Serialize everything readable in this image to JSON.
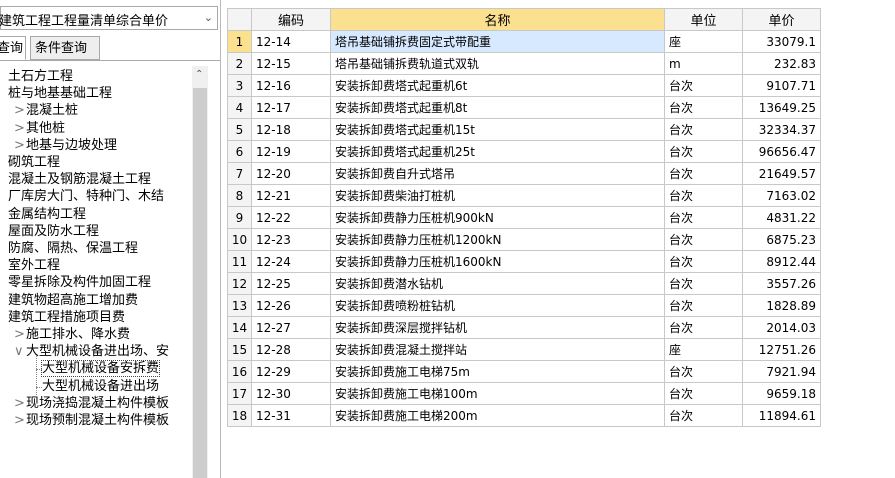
{
  "left_panel": {
    "library_select": "建筑工程工程量清单综合单价",
    "tabs": [
      "查询",
      "条件查询"
    ],
    "tree": [
      {
        "label": "土石方工程",
        "depth": 0,
        "toggle": ""
      },
      {
        "label": "桩与地基基础工程",
        "depth": 0,
        "toggle": ""
      },
      {
        "label": "混凝土桩",
        "depth": 1,
        "toggle": ">"
      },
      {
        "label": "其他桩",
        "depth": 1,
        "toggle": ">"
      },
      {
        "label": "地基与边坡处理",
        "depth": 1,
        "toggle": ">"
      },
      {
        "label": "砌筑工程",
        "depth": 0,
        "toggle": ""
      },
      {
        "label": "混凝土及钢筋混凝土工程",
        "depth": 0,
        "toggle": ""
      },
      {
        "label": "厂库房大门、特种门、木结",
        "depth": 0,
        "toggle": ""
      },
      {
        "label": "金属结构工程",
        "depth": 0,
        "toggle": ""
      },
      {
        "label": "屋面及防水工程",
        "depth": 0,
        "toggle": ""
      },
      {
        "label": "防腐、隔热、保温工程",
        "depth": 0,
        "toggle": ""
      },
      {
        "label": "室外工程",
        "depth": 0,
        "toggle": ""
      },
      {
        "label": "零星拆除及构件加固工程",
        "depth": 0,
        "toggle": ""
      },
      {
        "label": "建筑物超高施工增加费",
        "depth": 0,
        "toggle": ""
      },
      {
        "label": "建筑工程措施项目费",
        "depth": 0,
        "toggle": ""
      },
      {
        "label": "施工排水、降水费",
        "depth": 1,
        "toggle": ">"
      },
      {
        "label": "大型机械设备进出场、安",
        "depth": 1,
        "toggle": "v"
      },
      {
        "label": "大型机械设备安拆费",
        "depth": 2,
        "toggle": "",
        "selected": true
      },
      {
        "label": "大型机械设备进出场",
        "depth": 2,
        "toggle": ""
      },
      {
        "label": "现场浇捣混凝土构件模板",
        "depth": 1,
        "toggle": ">"
      },
      {
        "label": "现场预制混凝土构件模板",
        "depth": 1,
        "toggle": ">"
      }
    ]
  },
  "grid": {
    "columns": [
      "编码",
      "名称",
      "单位",
      "单价"
    ],
    "rows": [
      {
        "n": "1",
        "code": "12-14",
        "name": "塔吊基础铺拆费固定式带配重",
        "unit": "座",
        "price": "33079.1"
      },
      {
        "n": "2",
        "code": "12-15",
        "name": "塔吊基础铺拆费轨道式双轨",
        "unit": "m",
        "price": "232.83"
      },
      {
        "n": "3",
        "code": "12-16",
        "name": "安装拆卸费塔式起重机6t",
        "unit": "台次",
        "price": "9107.71"
      },
      {
        "n": "4",
        "code": "12-17",
        "name": "安装拆卸费塔式起重机8t",
        "unit": "台次",
        "price": "13649.25"
      },
      {
        "n": "5",
        "code": "12-18",
        "name": "安装拆卸费塔式起重机15t",
        "unit": "台次",
        "price": "32334.37"
      },
      {
        "n": "6",
        "code": "12-19",
        "name": "安装拆卸费塔式起重机25t",
        "unit": "台次",
        "price": "96656.47"
      },
      {
        "n": "7",
        "code": "12-20",
        "name": "安装拆卸费自升式塔吊",
        "unit": "台次",
        "price": "21649.57"
      },
      {
        "n": "8",
        "code": "12-21",
        "name": "安装拆卸费柴油打桩机",
        "unit": "台次",
        "price": "7163.02"
      },
      {
        "n": "9",
        "code": "12-22",
        "name": "安装拆卸费静力压桩机900kN",
        "unit": "台次",
        "price": "4831.22"
      },
      {
        "n": "10",
        "code": "12-23",
        "name": "安装拆卸费静力压桩机1200kN",
        "unit": "台次",
        "price": "6875.23"
      },
      {
        "n": "11",
        "code": "12-24",
        "name": "安装拆卸费静力压桩机1600kN",
        "unit": "台次",
        "price": "8912.44"
      },
      {
        "n": "12",
        "code": "12-25",
        "name": "安装拆卸费潜水钻机",
        "unit": "台次",
        "price": "3557.26"
      },
      {
        "n": "13",
        "code": "12-26",
        "name": "安装拆卸费喷粉桩钻机",
        "unit": "台次",
        "price": "1828.89"
      },
      {
        "n": "14",
        "code": "12-27",
        "name": "安装拆卸费深层搅拌钻机",
        "unit": "台次",
        "price": "2014.03"
      },
      {
        "n": "15",
        "code": "12-28",
        "name": "安装拆卸费混凝土搅拌站",
        "unit": "座",
        "price": "12751.26"
      },
      {
        "n": "16",
        "code": "12-29",
        "name": "安装拆卸费施工电梯75m",
        "unit": "台次",
        "price": "7921.94"
      },
      {
        "n": "17",
        "code": "12-30",
        "name": "安装拆卸费施工电梯100m",
        "unit": "台次",
        "price": "9659.18"
      },
      {
        "n": "18",
        "code": "12-31",
        "name": "安装拆卸费施工电梯200m",
        "unit": "台次",
        "price": "11894.61"
      }
    ]
  }
}
